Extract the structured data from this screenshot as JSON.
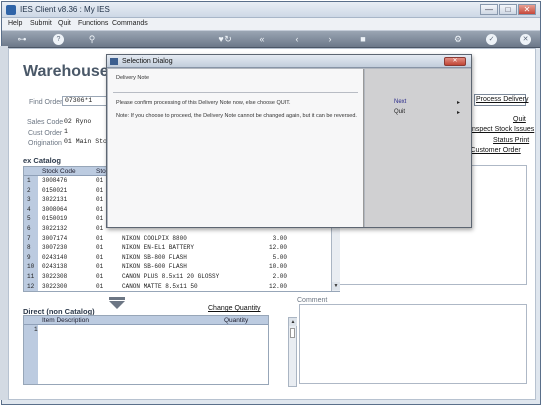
{
  "window": {
    "title": "IES Client v8.36 : My IES",
    "minimize": "—",
    "maximize": "□",
    "close": "✕"
  },
  "menu": [
    "Help",
    "Submit",
    "Quit",
    "Functions",
    "Commands"
  ],
  "page": {
    "title": "Warehouse Or"
  },
  "form": {
    "find_order_label": "Find Order",
    "find_order_value": "07306*1",
    "sales_code_label": "Sales Code",
    "sales_code_value": "02 Ryno",
    "cust_order_label": "Cust Order",
    "cust_order_value": "1",
    "origination_label": "Origination",
    "origination_value": "01 Main Stor"
  },
  "links": {
    "process_delivery": "Process Delivery",
    "quit": "Quit",
    "inspect_stock": "nspect Stock Issues",
    "status_print": "Status Print",
    "customer_order": "l Customer Order",
    "change_quantity": "Change Quantity"
  },
  "catalog": {
    "title": "ex Catalog",
    "headers": [
      "Stock Code",
      "Sto"
    ],
    "rows": [
      {
        "n": "1",
        "code": "3008476",
        "sto": "01",
        "desc": "",
        "qty": ""
      },
      {
        "n": "2",
        "code": "0150021",
        "sto": "01",
        "desc": "",
        "qty": ""
      },
      {
        "n": "3",
        "code": "3022131",
        "sto": "01",
        "desc": "",
        "qty": ""
      },
      {
        "n": "4",
        "code": "3008064",
        "sto": "01",
        "desc": "",
        "qty": ""
      },
      {
        "n": "5",
        "code": "0150019",
        "sto": "01",
        "desc": "",
        "qty": ""
      },
      {
        "n": "6",
        "code": "3022132",
        "sto": "01",
        "desc": "",
        "qty": ""
      },
      {
        "n": "7",
        "code": "3007174",
        "sto": "01",
        "desc": "NIKON COOLPIX 8800",
        "qty": "3.00"
      },
      {
        "n": "8",
        "code": "3007230",
        "sto": "01",
        "desc": "NIKON EN-EL1 BATTERY",
        "qty": "12.00"
      },
      {
        "n": "9",
        "code": "0243140",
        "sto": "01",
        "desc": "NIKON SB-800 FLASH",
        "qty": "5.00"
      },
      {
        "n": "10",
        "code": "0243138",
        "sto": "01",
        "desc": "NIKON SB-600 FLASH",
        "qty": "10.00"
      },
      {
        "n": "11",
        "code": "3022308",
        "sto": "01",
        "desc": "CANON PLUS 8.5x11 20 GLOSSY",
        "qty": "2.00"
      },
      {
        "n": "12",
        "code": "3022300",
        "sto": "01",
        "desc": "CANON MATTE 8.5x11 50",
        "qty": "12.00"
      }
    ]
  },
  "direct": {
    "title": "Direct (non Catalog)",
    "headers": [
      "Item Description",
      "Quantity"
    ],
    "first_row_number": "1"
  },
  "comment": {
    "label": "Comment"
  },
  "dialog": {
    "title": "Selection Dialog",
    "subtitle": "Delivery Note",
    "message": "Please confirm processing of this Delivery Note now, else choose QUIT.",
    "note": "Note: If you choose to proceed, the Delivery Note cannot be changed again, but it can be reversed.",
    "options": [
      "Next",
      "Quit"
    ],
    "accent_color": "#2a2a8a"
  }
}
